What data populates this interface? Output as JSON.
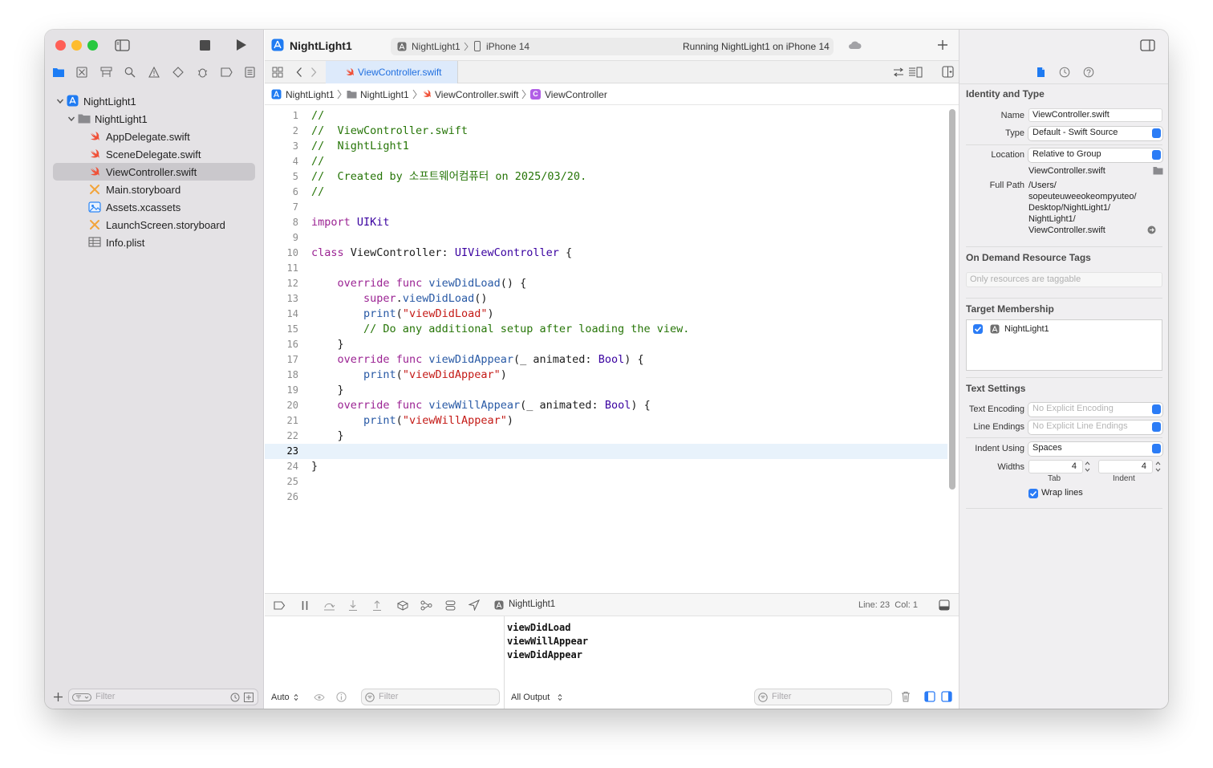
{
  "window": {
    "project_title": "NightLight1",
    "scheme": "NightLight1",
    "destination": "iPhone 14",
    "run_status": "Running NightLight1 on iPhone 14"
  },
  "navigator": {
    "items": [
      {
        "label": "NightLight1",
        "icon": "project-icon",
        "level": 0,
        "expanded": true
      },
      {
        "label": "NightLight1",
        "icon": "folder-icon",
        "level": 1,
        "expanded": true
      },
      {
        "label": "AppDelegate.swift",
        "icon": "swift-file-icon",
        "level": 2
      },
      {
        "label": "SceneDelegate.swift",
        "icon": "swift-file-icon",
        "level": 2
      },
      {
        "label": "ViewController.swift",
        "icon": "swift-file-icon",
        "level": 2,
        "selected": true
      },
      {
        "label": "Main.storyboard",
        "icon": "storyboard-icon",
        "level": 2
      },
      {
        "label": "Assets.xcassets",
        "icon": "assets-icon",
        "level": 2
      },
      {
        "label": "LaunchScreen.storyboard",
        "icon": "storyboard-icon",
        "level": 2
      },
      {
        "label": "Info.plist",
        "icon": "plist-icon",
        "level": 2
      }
    ],
    "filter_placeholder": "Filter"
  },
  "editor": {
    "tab_label": "ViewController.swift",
    "breadcrumb": [
      "NightLight1",
      "NightLight1",
      "ViewController.swift",
      "ViewController"
    ],
    "current_line": 23,
    "lines": [
      "//",
      "//  ViewController.swift",
      "//  NightLight1",
      "//",
      "//  Created by 소프트웨어컴퓨터 on 2025/03/20.",
      "//",
      "",
      "import UIKit",
      "",
      "class ViewController: UIViewController {",
      "",
      "    override func viewDidLoad() {",
      "        super.viewDidLoad()",
      "        print(\"viewDidLoad\")",
      "        // Do any additional setup after loading the view.",
      "    }",
      "    override func viewDidAppear(_ animated: Bool) {",
      "        print(\"viewDidAppear\")",
      "    }",
      "    override func viewWillAppear(_ animated: Bool) {",
      "        print(\"viewWillAppear\")",
      "    }",
      "",
      "}",
      "",
      ""
    ]
  },
  "debug": {
    "process_label": "NightLight1",
    "cursor_position": "Line: 23  Col: 1",
    "variables_mode": "Auto",
    "output_mode": "All Output",
    "filter_placeholder": "Filter",
    "console_lines": [
      "viewDidLoad",
      "viewWillAppear",
      "viewDidAppear"
    ]
  },
  "inspector": {
    "identity_title": "Identity and Type",
    "name_label": "Name",
    "name_value": "ViewController.swift",
    "type_label": "Type",
    "type_value": "Default - Swift Source",
    "location_label": "Location",
    "location_value": "Relative to Group",
    "location_file": "ViewController.swift",
    "full_path_label": "Full Path",
    "full_path_lines": [
      "/Users/",
      "sopeuteuweeokeompyuteo/",
      "Desktop/NightLight1/",
      "NightLight1/",
      "ViewController.swift"
    ],
    "odr_title": "On Demand Resource Tags",
    "odr_placeholder": "Only resources are taggable",
    "target_title": "Target Membership",
    "target_name": "NightLight1",
    "text_settings_title": "Text Settings",
    "encoding_label": "Text Encoding",
    "encoding_value": "No Explicit Encoding",
    "line_endings_label": "Line Endings",
    "line_endings_value": "No Explicit Line Endings",
    "indent_using_label": "Indent Using",
    "indent_using_value": "Spaces",
    "widths_label": "Widths",
    "tab_width": "4",
    "indent_width": "4",
    "tab_caption": "Tab",
    "indent_caption": "Indent",
    "wrap_label": "Wrap lines"
  },
  "colors": {
    "accent": "#2b7cf6",
    "keyword": "#9b2393",
    "type": "#3900a0",
    "string": "#c41a16",
    "comment": "#267507",
    "function": "#2859a5",
    "swift_orange": "#f05138"
  }
}
